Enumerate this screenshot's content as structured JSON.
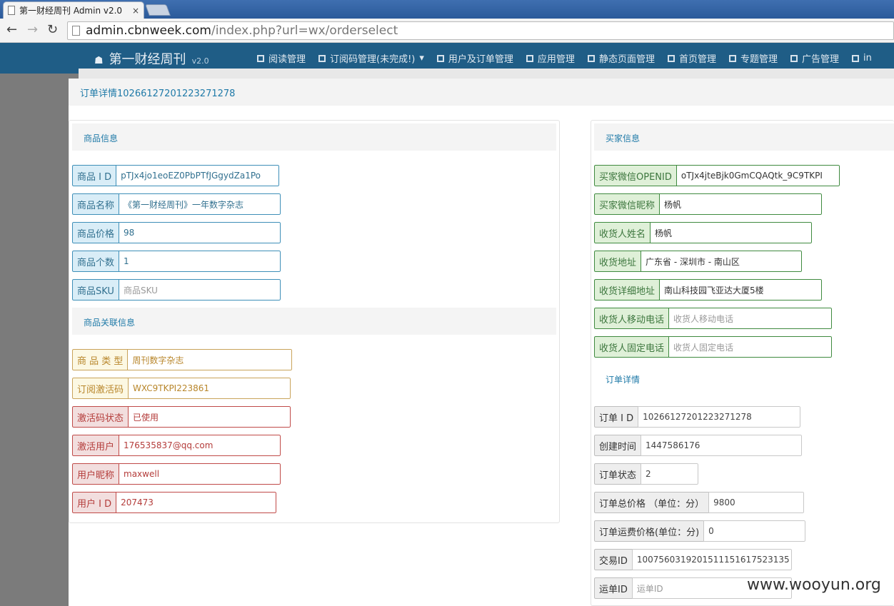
{
  "browser": {
    "tab_title": "第一财经周刊 Admin v2.0",
    "close_glyph": "×",
    "window_label": "",
    "url_host": "admin.cbnweek.com",
    "url_path": "/index.php?url=wx/orderselect"
  },
  "site": {
    "brand": "第一财经周刊",
    "version": "v2.0",
    "menu": [
      "阅读管理",
      "订阅码管理(未完成!)",
      "用户及订单管理",
      "应用管理",
      "静态页面管理",
      "首页管理",
      "专题管理",
      "广告管理",
      "in"
    ],
    "menu_caret": "▾"
  },
  "modal": {
    "title": "订单详情10266127201223271278",
    "product_section": "商品信息",
    "product_fields": [
      {
        "label": "商品 I D",
        "value": "pTJx4jo1eoEZ0PbPTfJGgydZa1Po"
      },
      {
        "label": "商品名称",
        "value": "《第一财经周刊》一年数字杂志"
      },
      {
        "label": "商品价格",
        "value": "98"
      },
      {
        "label": "商品个数",
        "value": "1"
      },
      {
        "label": "商品SKU",
        "value": "商品SKU"
      }
    ],
    "related_section": "商品关联信息",
    "related_fields": [
      {
        "label": "商 品 类 型",
        "value": "周刊数字杂志"
      },
      {
        "label": "订阅激活码",
        "value": "WXC9TKPI223861"
      },
      {
        "label": "激活码状态",
        "value": "已使用"
      },
      {
        "label": "激活用户",
        "value": "176535837@qq.com"
      },
      {
        "label": "用户昵称",
        "value": "maxwell"
      },
      {
        "label": "用户 I D",
        "value": "207473"
      }
    ],
    "buyer_section": "买家信息",
    "buyer_fields": [
      {
        "label": "买家微信OPENID",
        "value": "oTJx4jteBjk0GmCQAQtk_9C9TKPI"
      },
      {
        "label": "买家微信昵称",
        "value": "杨帆"
      },
      {
        "label": "收货人姓名",
        "value": "杨帆"
      },
      {
        "label": "收货地址",
        "value": "广东省 - 深圳市 - 南山区"
      },
      {
        "label": "收货详细地址",
        "value": "南山科技园飞亚达大厦5楼"
      },
      {
        "label": "收货人移动电话",
        "value": "收货人移动电话"
      },
      {
        "label": "收货人固定电话",
        "value": "收货人固定电话"
      }
    ],
    "order_section": "订单详情",
    "order_fields": [
      {
        "label": "订单 I D",
        "value": "10266127201223271278"
      },
      {
        "label": "创建时间",
        "value": "1447586176"
      },
      {
        "label": "订单状态",
        "value": "2"
      },
      {
        "label": "订单总价格 （单位：分）",
        "value": "9800"
      },
      {
        "label": "订单运费价格(单位：分)",
        "value": "0"
      },
      {
        "label": "交易ID",
        "value": "1007560319201511151617523135"
      },
      {
        "label": "运单ID",
        "value": "运单ID"
      }
    ]
  },
  "watermark": "www.wooyun.org"
}
